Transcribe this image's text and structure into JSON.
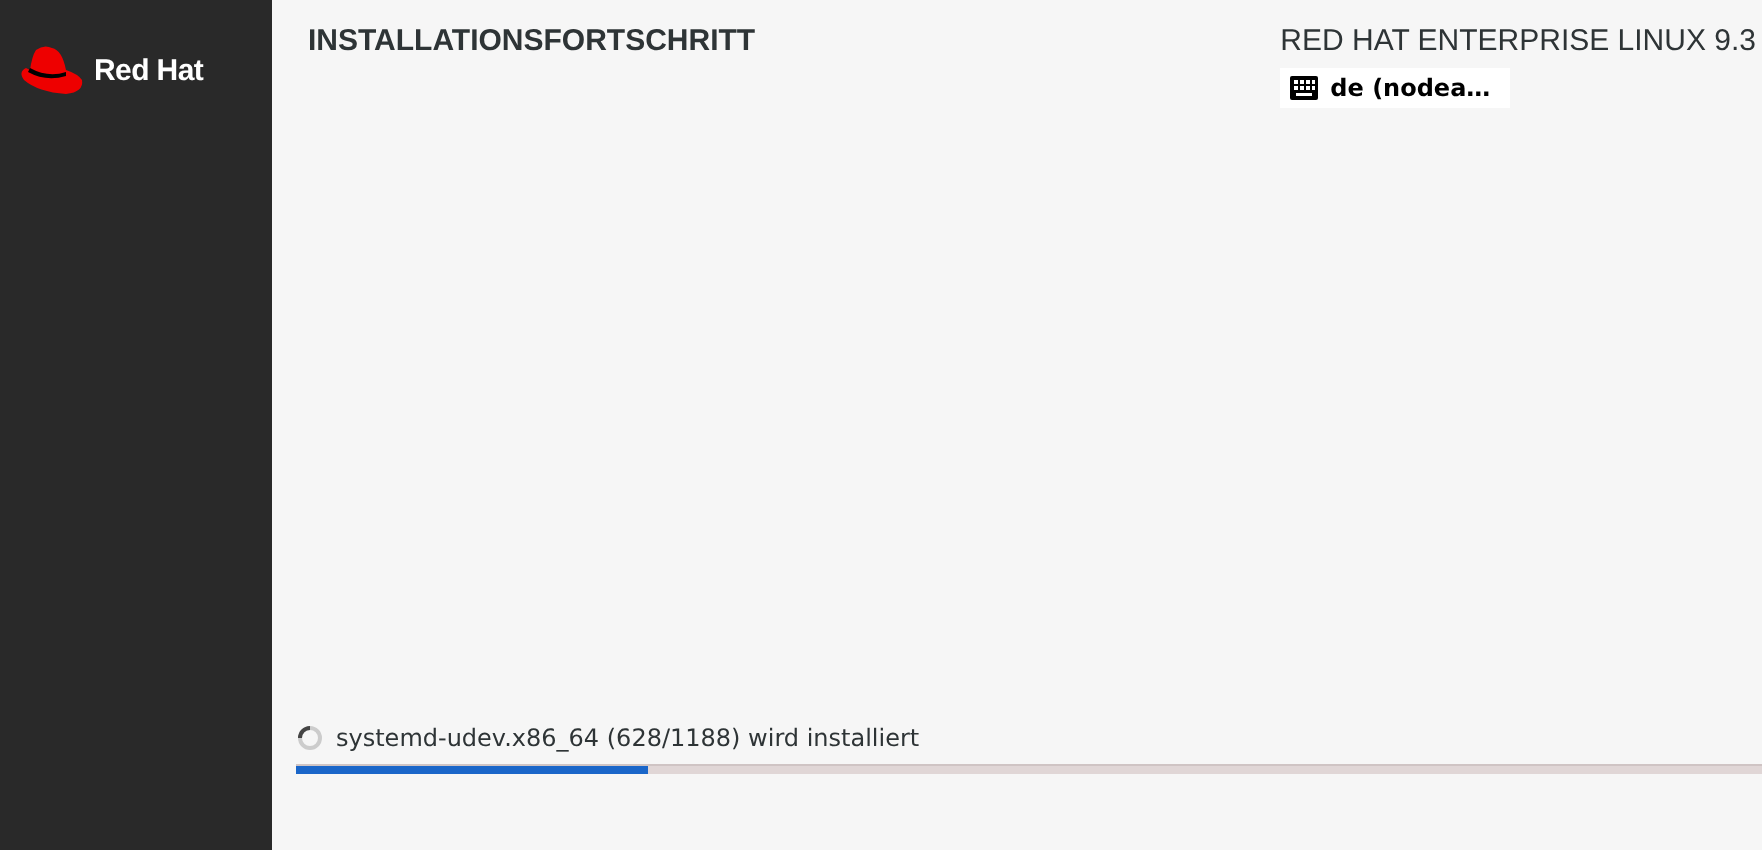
{
  "sidebar": {
    "logo_text": "Red Hat"
  },
  "header": {
    "title": "INSTALLATIONSFORTSCHRITT",
    "product": "RED HAT ENTERPRISE LINUX 9.3",
    "keyboard_layout": "de (nodea…"
  },
  "progress": {
    "status": "systemd-udev.x86_64 (628/1188) wird installiert",
    "level": 0.24
  }
}
